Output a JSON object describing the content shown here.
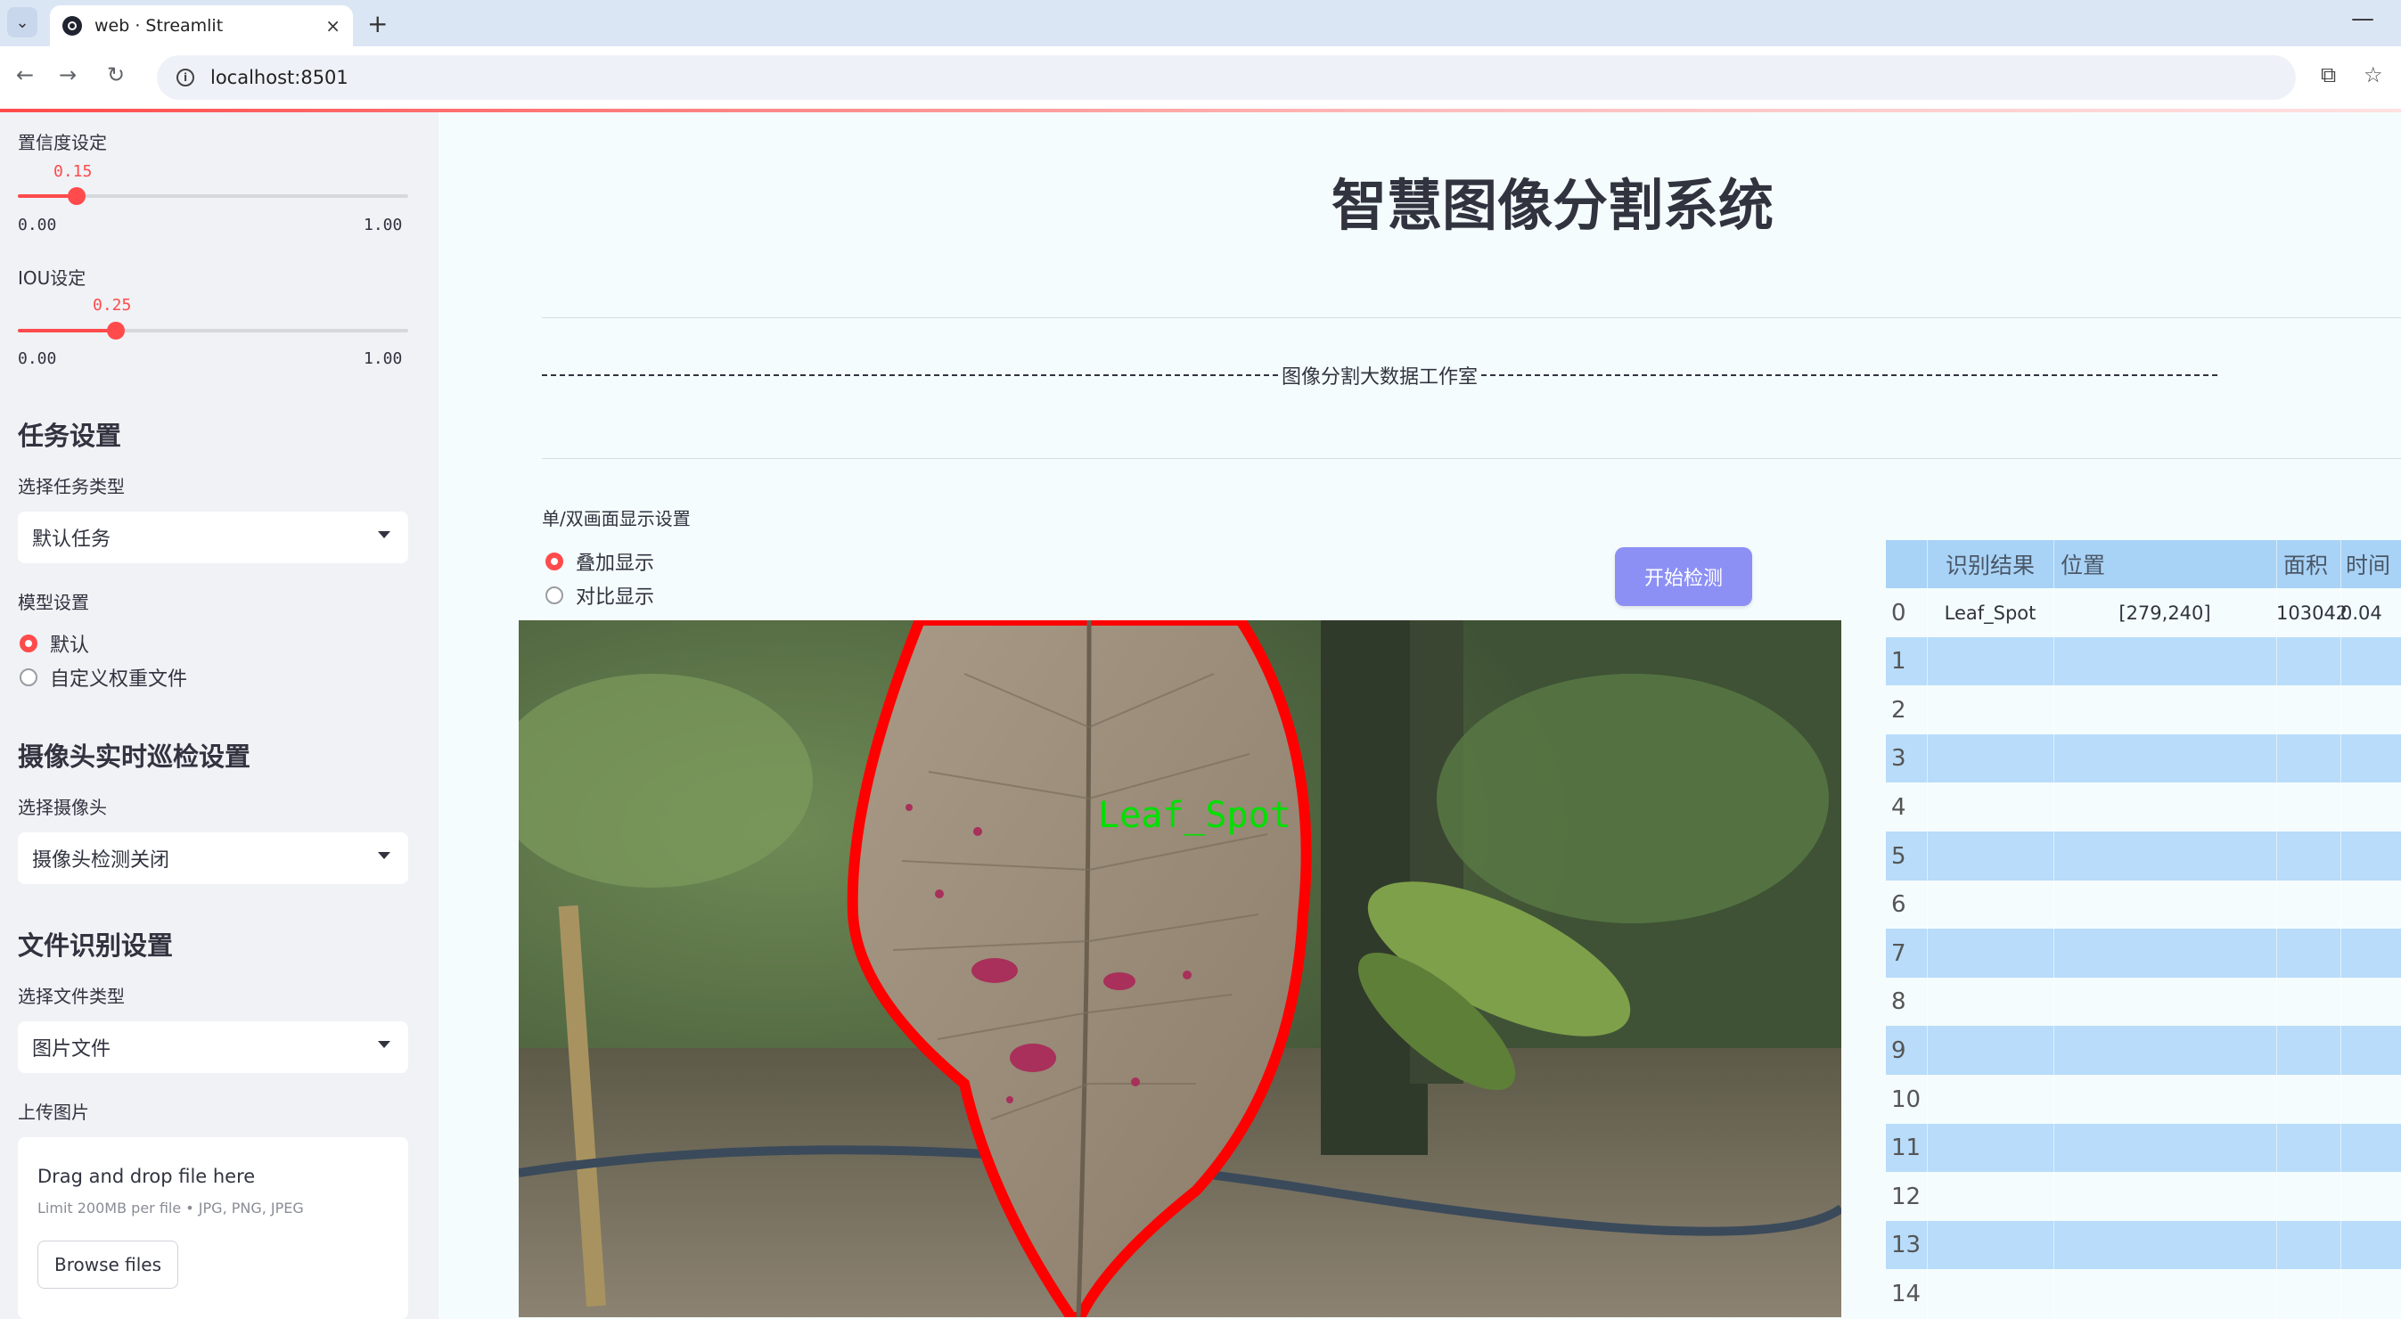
{
  "browser": {
    "tab_title": "web · Streamlit",
    "url": "localhost:8501",
    "tab_close": "×",
    "new_tab": "+",
    "minimize": "—"
  },
  "sidebar": {
    "confidence": {
      "label": "置信度设定",
      "value": "0.15",
      "value_num": 0.15,
      "min": "0.00",
      "max": "1.00"
    },
    "iou": {
      "label": "IOU设定",
      "value": "0.25",
      "value_num": 0.25,
      "min": "0.00",
      "max": "1.00"
    },
    "task_heading": "任务设置",
    "task_type_label": "选择任务类型",
    "task_type_value": "默认任务",
    "model_label": "模型设置",
    "model_options": [
      "默认",
      "自定义权重文件"
    ],
    "model_selected": "默认",
    "camera_heading": "摄像头实时巡检设置",
    "camera_label": "选择摄像头",
    "camera_value": "摄像头检测关闭",
    "file_heading": "文件识别设置",
    "file_type_label": "选择文件类型",
    "file_type_value": "图片文件",
    "upload_label": "上传图片",
    "upload_dd": "Drag and drop file here",
    "upload_limit": "Limit 200MB per file • JPG, PNG, JPEG",
    "browse_label": "Browse files"
  },
  "main": {
    "title": "智慧图像分割系统",
    "dash_center": "图像分割大数据工作室",
    "display_label": "单/双画面显示设置",
    "display_options": [
      "叠加显示",
      "对比显示"
    ],
    "display_selected": "叠加显示",
    "detect_button": "开始检测",
    "detection_label": "Leaf_Spot"
  },
  "table": {
    "headers": [
      "识别结果",
      "位置",
      "面积",
      "时间"
    ],
    "rows": [
      {
        "idx": "0",
        "name": "Leaf_Spot",
        "pos": "[279,240]",
        "area": "103042",
        "time": "0.04"
      },
      {
        "idx": "1",
        "name": "",
        "pos": "",
        "area": "",
        "time": ""
      },
      {
        "idx": "2",
        "name": "",
        "pos": "",
        "area": "",
        "time": ""
      },
      {
        "idx": "3",
        "name": "",
        "pos": "",
        "area": "",
        "time": ""
      },
      {
        "idx": "4",
        "name": "",
        "pos": "",
        "area": "",
        "time": ""
      },
      {
        "idx": "5",
        "name": "",
        "pos": "",
        "area": "",
        "time": ""
      },
      {
        "idx": "6",
        "name": "",
        "pos": "",
        "area": "",
        "time": ""
      },
      {
        "idx": "7",
        "name": "",
        "pos": "",
        "area": "",
        "time": ""
      },
      {
        "idx": "8",
        "name": "",
        "pos": "",
        "area": "",
        "time": ""
      },
      {
        "idx": "9",
        "name": "",
        "pos": "",
        "area": "",
        "time": ""
      },
      {
        "idx": "10",
        "name": "",
        "pos": "",
        "area": "",
        "time": ""
      },
      {
        "idx": "11",
        "name": "",
        "pos": "",
        "area": "",
        "time": ""
      },
      {
        "idx": "12",
        "name": "",
        "pos": "",
        "area": "",
        "time": ""
      },
      {
        "idx": "13",
        "name": "",
        "pos": "",
        "area": "",
        "time": ""
      },
      {
        "idx": "14",
        "name": "",
        "pos": "",
        "area": "",
        "time": ""
      }
    ]
  },
  "colors": {
    "accent": "#ff4b4b",
    "button": "#8c90f5",
    "table_header": "#a9d3f6",
    "table_alt": "#b8dcfa",
    "mask_outline": "#ff0000",
    "label_green": "#00e000"
  },
  "icons": [
    "chevron-down-icon",
    "back-icon",
    "forward-icon",
    "reload-icon",
    "info-icon",
    "translate-icon",
    "star-icon"
  ]
}
